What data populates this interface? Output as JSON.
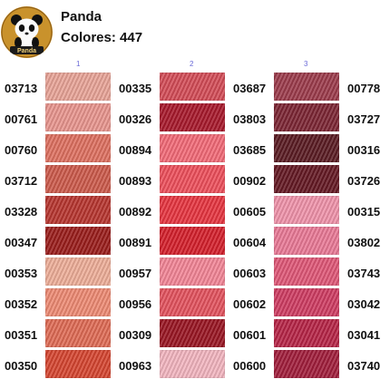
{
  "header": {
    "brand": "Panda",
    "count_text": "Colores: 447",
    "logo_text": "Panda"
  },
  "column_numbers": [
    "1",
    "2",
    "3"
  ],
  "columns": [
    [
      {
        "code": "03713",
        "color": "#e9a497"
      },
      {
        "code": "00761",
        "color": "#e9958e"
      },
      {
        "code": "00760",
        "color": "#df7060"
      },
      {
        "code": "03712",
        "color": "#cd5a4b"
      },
      {
        "code": "03328",
        "color": "#b8352f"
      },
      {
        "code": "00347",
        "color": "#9b1d1b"
      },
      {
        "code": "00353",
        "color": "#eeae98"
      },
      {
        "code": "00352",
        "color": "#ee8a73"
      },
      {
        "code": "00351",
        "color": "#e06b55"
      },
      {
        "code": "00350",
        "color": "#d64530"
      }
    ],
    [
      {
        "code": "00335",
        "color": "#d44c57"
      },
      {
        "code": "00326",
        "color": "#a8182b"
      },
      {
        "code": "00894",
        "color": "#f36a77"
      },
      {
        "code": "00893",
        "color": "#ee4f5b"
      },
      {
        "code": "00892",
        "color": "#e7343f"
      },
      {
        "code": "00891",
        "color": "#d51f2b"
      },
      {
        "code": "00957",
        "color": "#f38596"
      },
      {
        "code": "00956",
        "color": "#e4525e"
      },
      {
        "code": "00309",
        "color": "#9a1522"
      },
      {
        "code": "00963",
        "color": "#f3b5c0"
      }
    ],
    [
      {
        "code": "03687",
        "color": "#9c3b4b"
      },
      {
        "code": "03803",
        "color": "#7c2533"
      },
      {
        "code": "03685",
        "color": "#5a1b22"
      },
      {
        "code": "00902",
        "color": "#641823"
      },
      {
        "code": "00605",
        "color": "#f093aa"
      },
      {
        "code": "00604",
        "color": "#ea7996"
      },
      {
        "code": "00603",
        "color": "#e05777"
      },
      {
        "code": "00602",
        "color": "#cf3c62"
      },
      {
        "code": "00601",
        "color": "#b72446"
      },
      {
        "code": "00600",
        "color": "#a11d3b"
      }
    ],
    [
      {
        "code": "00778",
        "color": "#e8bcc2"
      },
      {
        "code": "03727",
        "color": "#d49aa8"
      },
      {
        "code": "00316",
        "color": "#b56f80"
      },
      {
        "code": "03726",
        "color": "#9e5565"
      },
      {
        "code": "00315",
        "color": "#7d3d4a"
      },
      {
        "code": "03802",
        "color": "#6c2b39"
      },
      {
        "code": "03743",
        "color": "#e0b6c1"
      },
      {
        "code": "03042",
        "color": "#c89aa6"
      },
      {
        "code": "03041",
        "color": "#9f7780"
      },
      {
        "code": "03740",
        "color": "#7e5a63"
      }
    ]
  ]
}
